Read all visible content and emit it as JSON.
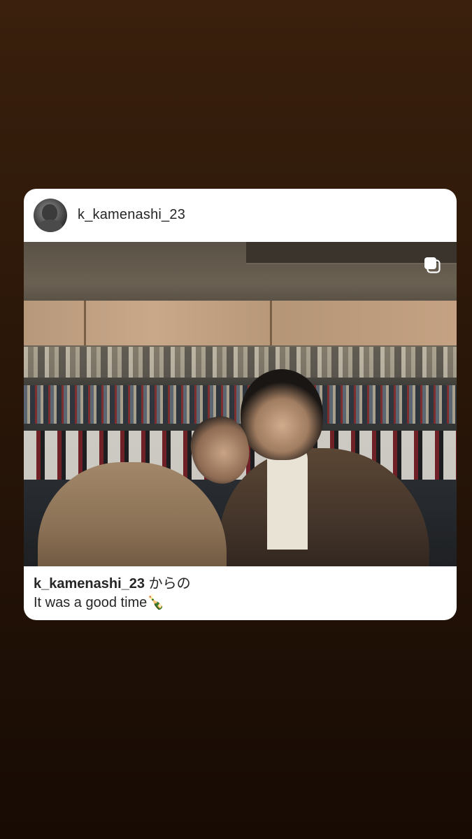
{
  "post": {
    "username": "k_kamenashi_23",
    "caption": {
      "username": "k_kamenashi_23",
      "suffix": " からの",
      "text": "It was a good time🍾"
    },
    "avatar_icon": "profile-avatar",
    "multi_media_icon": "carousel-icon"
  },
  "colors": {
    "background_top": "#3a200d",
    "background_bottom": "#170b04",
    "card": "#ffffff",
    "text": "#262626"
  }
}
